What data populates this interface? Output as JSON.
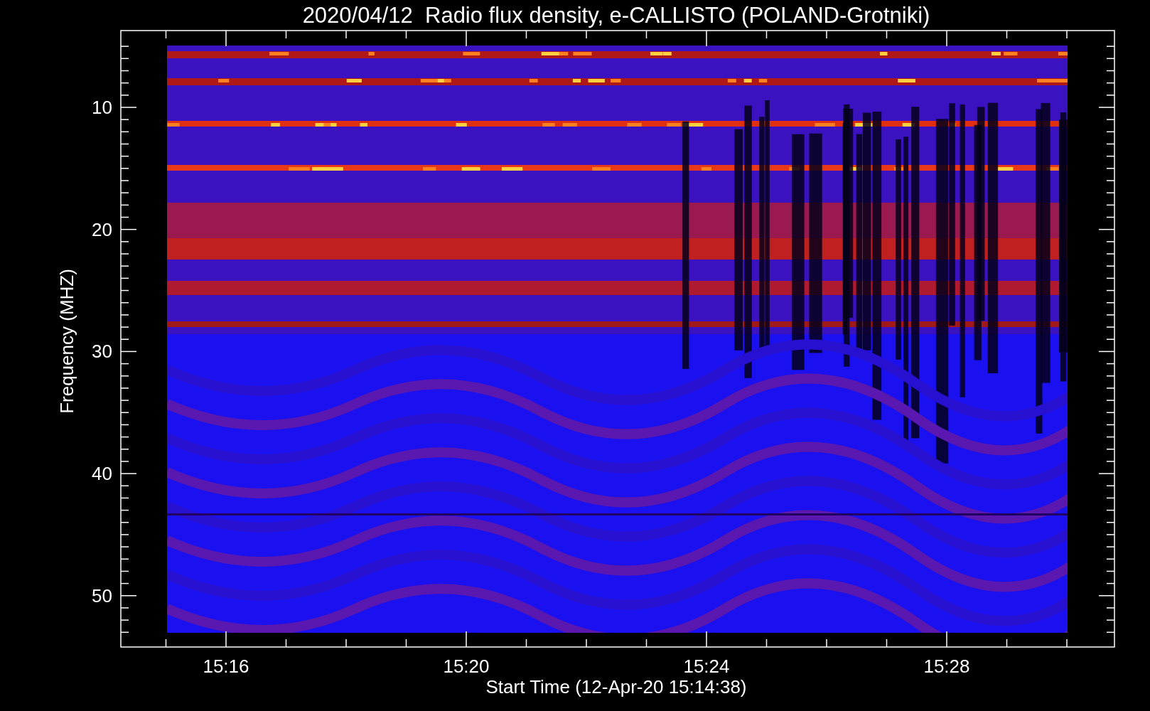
{
  "title": "2020/04/12  Radio flux density, e-CALLISTO (POLAND-Grotniki)",
  "y_axis": {
    "label": "Frequency (MHZ)",
    "ticks": [
      "10",
      "20",
      "30",
      "40",
      "50"
    ]
  },
  "x_axis": {
    "label": "Start Time (12-Apr-20 15:14:38)",
    "ticks": [
      "15:16",
      "15:20",
      "15:24",
      "15:28"
    ]
  }
}
